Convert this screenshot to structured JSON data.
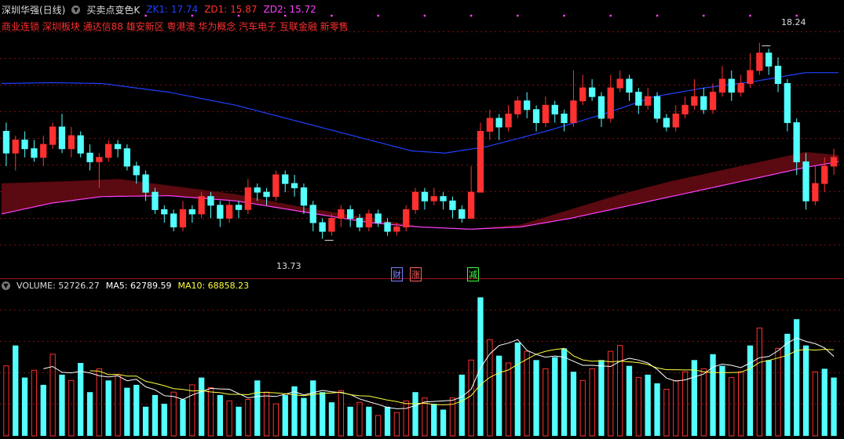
{
  "header": {
    "stock": "深圳华强(日线)",
    "indicator": "买卖点变色K",
    "zk1_label": "ZK1: 17.74",
    "zd1_label": "ZD1: 15.87",
    "zd2_label": "ZD2: 15.72",
    "concepts": "商业连锁 深圳板块 通达信88 雄安新区 粤港澳 华为概念 汽车电子 互联金融 新零售"
  },
  "volume_header": {
    "volume_label": "VOLUME: 52726.27",
    "ma5_label": "MA5: 62789.59",
    "ma10_label": "MA10: 68858.23"
  },
  "events": {
    "cai": "财",
    "zhang": "涨",
    "jian": "减"
  },
  "colors": {
    "up": "#ff3030",
    "down": "#54ffff",
    "zk1": "#2040ff",
    "zd1": "#ff3030",
    "zd2": "#ff40ff",
    "ma5": "#ffffff",
    "ma10": "#ffff40",
    "band_up": "#5a0a10",
    "band_down": "#0a6a0a"
  },
  "chart_data": {
    "type": "candlestick",
    "price_range": [
      13.0,
      18.5
    ],
    "annotations": {
      "high": "18.24",
      "low": "13.73"
    },
    "candles": [
      [
        16.2,
        15.7,
        16.4,
        15.4
      ],
      [
        15.7,
        16.0,
        16.1,
        15.3
      ],
      [
        16.0,
        15.8,
        16.2,
        15.6
      ],
      [
        15.8,
        15.6,
        16.0,
        15.5
      ],
      [
        15.6,
        15.9,
        16.1,
        15.4
      ],
      [
        15.9,
        16.3,
        16.4,
        15.8
      ],
      [
        16.3,
        15.8,
        16.6,
        15.7
      ],
      [
        15.8,
        16.1,
        16.3,
        15.6
      ],
      [
        16.1,
        15.7,
        16.2,
        15.6
      ],
      [
        15.7,
        15.5,
        15.9,
        15.3
      ],
      [
        15.5,
        15.6,
        15.7,
        14.9
      ],
      [
        15.6,
        15.9,
        16.0,
        15.5
      ],
      [
        15.9,
        15.8,
        16.0,
        15.6
      ],
      [
        15.8,
        15.4,
        15.9,
        15.3
      ],
      [
        15.4,
        15.2,
        15.5,
        15.0
      ],
      [
        15.2,
        14.8,
        15.3,
        14.6
      ],
      [
        14.8,
        14.4,
        14.9,
        14.3
      ],
      [
        14.4,
        14.3,
        14.5,
        14.1
      ],
      [
        14.3,
        14.0,
        14.4,
        13.9
      ],
      [
        14.0,
        14.4,
        14.6,
        13.9
      ],
      [
        14.4,
        14.3,
        14.5,
        14.1
      ],
      [
        14.3,
        14.7,
        14.8,
        14.2
      ],
      [
        14.7,
        14.5,
        14.8,
        14.2
      ],
      [
        14.5,
        14.2,
        14.6,
        14.0
      ],
      [
        14.2,
        14.5,
        14.6,
        14.1
      ],
      [
        14.5,
        14.4,
        14.6,
        14.2
      ],
      [
        14.4,
        14.9,
        15.1,
        14.3
      ],
      [
        14.9,
        14.8,
        15.0,
        14.6
      ],
      [
        14.8,
        14.7,
        14.9,
        14.5
      ],
      [
        14.7,
        15.2,
        15.3,
        14.6
      ],
      [
        15.2,
        15.0,
        15.3,
        14.8
      ],
      [
        15.0,
        14.9,
        15.2,
        14.7
      ],
      [
        14.9,
        14.5,
        15.0,
        14.3
      ],
      [
        14.5,
        14.1,
        14.6,
        13.9
      ],
      [
        14.1,
        13.9,
        14.2,
        13.73
      ],
      [
        13.9,
        14.2,
        14.3,
        13.8
      ],
      [
        14.2,
        14.4,
        14.5,
        14.0
      ],
      [
        14.4,
        14.2,
        14.5,
        14.0
      ],
      [
        14.2,
        14.0,
        14.3,
        13.9
      ],
      [
        14.0,
        14.3,
        14.4,
        13.9
      ],
      [
        14.3,
        14.1,
        14.4,
        14.0
      ],
      [
        14.1,
        13.9,
        14.2,
        13.8
      ],
      [
        13.9,
        14.0,
        14.1,
        13.8
      ],
      [
        14.0,
        14.4,
        14.5,
        13.9
      ],
      [
        14.4,
        14.8,
        14.9,
        14.3
      ],
      [
        14.8,
        14.6,
        14.9,
        14.4
      ],
      [
        14.6,
        14.7,
        14.9,
        14.5
      ],
      [
        14.7,
        14.6,
        14.8,
        14.4
      ],
      [
        14.6,
        14.4,
        14.7,
        14.2
      ],
      [
        14.4,
        14.2,
        14.5,
        14.1
      ],
      [
        14.2,
        14.8,
        15.4,
        14.2
      ],
      [
        14.8,
        16.2,
        16.4,
        14.8
      ],
      [
        16.2,
        16.5,
        16.7,
        16.0
      ],
      [
        16.5,
        16.3,
        16.6,
        16.0
      ],
      [
        16.3,
        16.6,
        16.8,
        16.2
      ],
      [
        16.6,
        16.9,
        17.0,
        16.5
      ],
      [
        16.9,
        16.7,
        17.1,
        16.5
      ],
      [
        16.7,
        16.4,
        16.8,
        16.2
      ],
      [
        16.4,
        16.8,
        17.0,
        16.3
      ],
      [
        16.8,
        16.6,
        16.9,
        16.4
      ],
      [
        16.6,
        16.4,
        16.7,
        16.2
      ],
      [
        16.4,
        16.9,
        17.6,
        16.3
      ],
      [
        16.9,
        17.2,
        17.5,
        16.8
      ],
      [
        17.2,
        17.0,
        17.4,
        16.9
      ],
      [
        17.0,
        16.5,
        17.1,
        16.3
      ],
      [
        16.5,
        17.2,
        17.5,
        16.4
      ],
      [
        17.2,
        17.4,
        17.6,
        17.1
      ],
      [
        17.4,
        17.1,
        17.5,
        16.9
      ],
      [
        17.1,
        16.8,
        17.2,
        16.6
      ],
      [
        16.8,
        17.0,
        17.2,
        16.7
      ],
      [
        17.0,
        16.5,
        17.1,
        16.4
      ],
      [
        16.5,
        16.3,
        16.6,
        16.2
      ],
      [
        16.3,
        16.6,
        16.8,
        16.2
      ],
      [
        16.6,
        16.8,
        17.0,
        16.5
      ],
      [
        16.8,
        17.0,
        17.4,
        16.7
      ],
      [
        17.0,
        16.7,
        17.2,
        16.6
      ],
      [
        16.7,
        17.1,
        17.3,
        16.6
      ],
      [
        17.1,
        17.4,
        17.7,
        17.0
      ],
      [
        17.4,
        17.1,
        17.6,
        16.9
      ],
      [
        17.1,
        17.3,
        17.5,
        17.0
      ],
      [
        17.3,
        17.6,
        18.0,
        17.2
      ],
      [
        17.6,
        18.0,
        18.24,
        17.5
      ],
      [
        18.0,
        17.7,
        18.1,
        17.5
      ],
      [
        17.7,
        17.3,
        17.9,
        17.1
      ],
      [
        17.3,
        16.4,
        17.4,
        16.2
      ],
      [
        16.4,
        15.5,
        16.5,
        15.2
      ],
      [
        15.5,
        14.6,
        15.7,
        14.4
      ],
      [
        14.6,
        15.0,
        15.4,
        14.5
      ],
      [
        15.0,
        15.4,
        15.6,
        14.8
      ],
      [
        15.4,
        15.6,
        15.8,
        15.2
      ]
    ],
    "volume": [
      [
        48,
        0
      ],
      [
        62,
        1
      ],
      [
        40,
        1
      ],
      [
        45,
        0
      ],
      [
        35,
        1
      ],
      [
        56,
        0
      ],
      [
        42,
        1
      ],
      [
        38,
        0
      ],
      [
        50,
        1
      ],
      [
        30,
        1
      ],
      [
        46,
        0
      ],
      [
        38,
        1
      ],
      [
        42,
        0
      ],
      [
        33,
        1
      ],
      [
        35,
        1
      ],
      [
        20,
        1
      ],
      [
        28,
        1
      ],
      [
        22,
        1
      ],
      [
        30,
        0
      ],
      [
        25,
        1
      ],
      [
        35,
        0
      ],
      [
        40,
        1
      ],
      [
        33,
        0
      ],
      [
        28,
        1
      ],
      [
        24,
        0
      ],
      [
        20,
        1
      ],
      [
        25,
        0
      ],
      [
        38,
        1
      ],
      [
        30,
        0
      ],
      [
        22,
        0
      ],
      [
        28,
        1
      ],
      [
        34,
        1
      ],
      [
        26,
        1
      ],
      [
        38,
        1
      ],
      [
        30,
        1
      ],
      [
        23,
        1
      ],
      [
        31,
        0
      ],
      [
        20,
        1
      ],
      [
        23,
        0
      ],
      [
        20,
        1
      ],
      [
        14,
        0
      ],
      [
        20,
        1
      ],
      [
        16,
        0
      ],
      [
        24,
        0
      ],
      [
        30,
        1
      ],
      [
        26,
        0
      ],
      [
        22,
        1
      ],
      [
        18,
        1
      ],
      [
        26,
        0
      ],
      [
        42,
        1
      ],
      [
        52,
        0
      ],
      [
        95,
        1
      ],
      [
        66,
        0
      ],
      [
        55,
        1
      ],
      [
        50,
        0
      ],
      [
        64,
        1
      ],
      [
        58,
        0
      ],
      [
        52,
        1
      ],
      [
        46,
        0
      ],
      [
        54,
        1
      ],
      [
        60,
        1
      ],
      [
        44,
        1
      ],
      [
        38,
        0
      ],
      [
        46,
        0
      ],
      [
        52,
        1
      ],
      [
        58,
        0
      ],
      [
        62,
        0
      ],
      [
        48,
        1
      ],
      [
        40,
        0
      ],
      [
        42,
        1
      ],
      [
        36,
        1
      ],
      [
        32,
        0
      ],
      [
        38,
        0
      ],
      [
        44,
        0
      ],
      [
        52,
        1
      ],
      [
        46,
        0
      ],
      [
        56,
        1
      ],
      [
        48,
        1
      ],
      [
        40,
        0
      ],
      [
        44,
        0
      ],
      [
        62,
        1
      ],
      [
        74,
        0
      ],
      [
        52,
        1
      ],
      [
        60,
        0
      ],
      [
        70,
        1
      ],
      [
        80,
        1
      ],
      [
        62,
        1
      ],
      [
        44,
        0
      ],
      [
        46,
        1
      ],
      [
        40,
        1
      ]
    ],
    "zk1": [
      [
        0,
        17.3
      ],
      [
        0.06,
        17.32
      ],
      [
        0.12,
        17.3
      ],
      [
        0.2,
        17.1
      ],
      [
        0.28,
        16.8
      ],
      [
        0.36,
        16.4
      ],
      [
        0.44,
        16.0
      ],
      [
        0.49,
        15.75
      ],
      [
        0.53,
        15.7
      ],
      [
        0.58,
        15.85
      ],
      [
        0.65,
        16.2
      ],
      [
        0.72,
        16.6
      ],
      [
        0.78,
        17.0
      ],
      [
        0.84,
        17.2
      ],
      [
        0.9,
        17.35
      ],
      [
        0.96,
        17.55
      ],
      [
        1,
        17.55
      ]
    ],
    "zd1": [
      [
        0,
        15.0
      ],
      [
        0.08,
        15.05
      ],
      [
        0.14,
        15.1
      ],
      [
        0.2,
        14.95
      ],
      [
        0.28,
        14.75
      ],
      [
        0.36,
        14.45
      ],
      [
        0.44,
        14.2
      ],
      [
        0.5,
        14.0
      ],
      [
        0.56,
        13.95
      ],
      [
        0.62,
        14.05
      ],
      [
        0.68,
        14.4
      ],
      [
        0.74,
        14.75
      ],
      [
        0.8,
        15.05
      ],
      [
        0.86,
        15.3
      ],
      [
        0.92,
        15.55
      ],
      [
        0.96,
        15.72
      ],
      [
        1,
        15.65
      ]
    ],
    "zd2": [
      [
        0,
        14.3
      ],
      [
        0.06,
        14.55
      ],
      [
        0.12,
        14.7
      ],
      [
        0.2,
        14.72
      ],
      [
        0.28,
        14.6
      ],
      [
        0.36,
        14.35
      ],
      [
        0.44,
        14.1
      ],
      [
        0.5,
        14.0
      ],
      [
        0.56,
        13.95
      ],
      [
        0.62,
        14.0
      ],
      [
        0.68,
        14.2
      ],
      [
        0.74,
        14.45
      ],
      [
        0.8,
        14.7
      ],
      [
        0.86,
        14.95
      ],
      [
        0.92,
        15.2
      ],
      [
        0.96,
        15.37
      ],
      [
        1,
        15.5
      ]
    ]
  }
}
